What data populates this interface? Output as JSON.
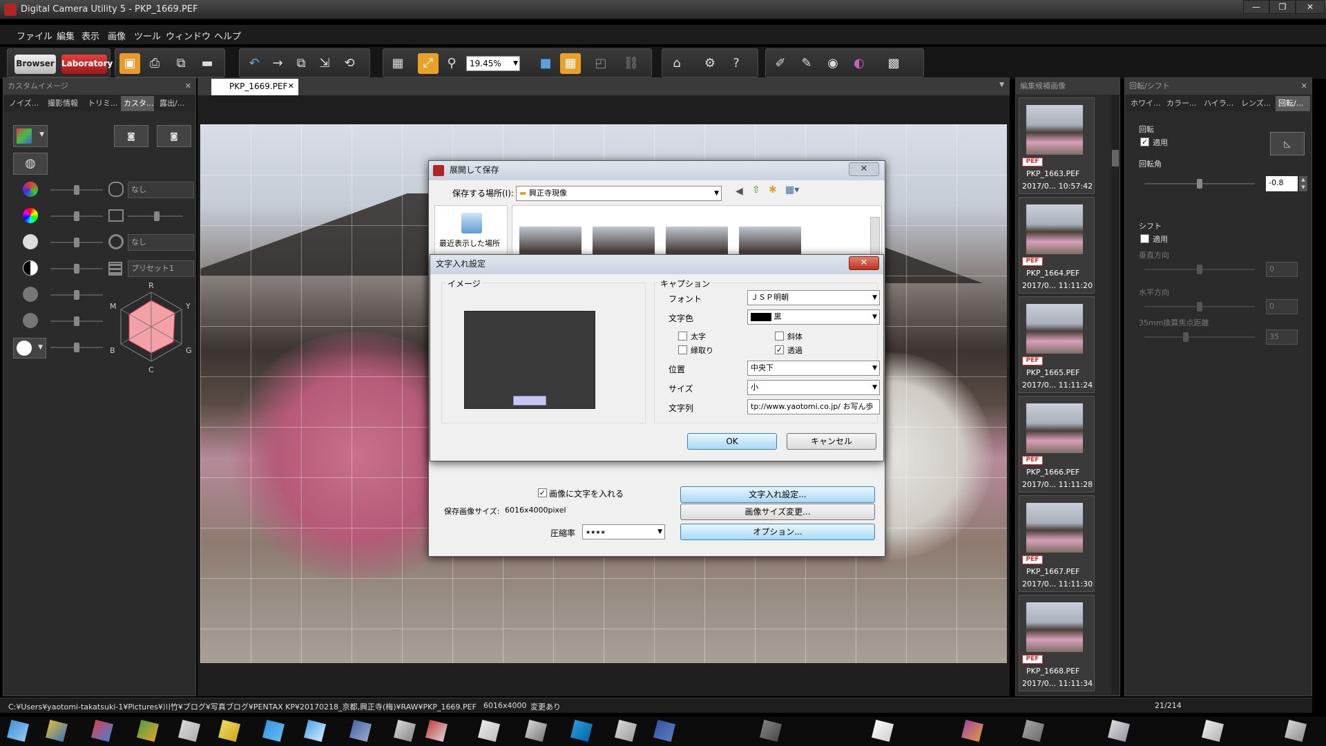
{
  "window": {
    "title": "Digital Camera Utility 5 - PKP_1669.PEF"
  },
  "menu": [
    "ファイル",
    "編集",
    "表示",
    "画像",
    "ツール",
    "ウィンドウ",
    "ヘルプ"
  ],
  "toolbar": {
    "browser_label": "Browser",
    "laboratory_label": "Laboratory",
    "zoom_value": "19.45%"
  },
  "left_panel": {
    "title": "カスタムイメージ",
    "tabs": [
      "ノイズ...",
      "撮影情報",
      "トリミ...",
      "カスタ...",
      "露出/..."
    ],
    "dropdowns": [
      "なし",
      "なし",
      "プリセット1"
    ],
    "radar_labels": {
      "top": "R",
      "top_right": "Y",
      "right": "G",
      "bottom": "C",
      "left": "B",
      "top_left": "M"
    }
  },
  "document": {
    "tab_label": "PKP_1669.PEF"
  },
  "save_dialog": {
    "title": "展開して保存",
    "save_location_label": "保存する場所(I):",
    "save_location_value": "興正寺現像",
    "recent_label": "最近表示した場所",
    "add_text_checkbox": "画像に文字を入れる",
    "add_text_checked": true,
    "save_size_label": "保存画像サイズ:",
    "save_size_value": "6016x4000pixel",
    "compression_label": "圧縮率",
    "compression_value": "★★★★",
    "text_settings_button": "文字入れ設定...",
    "resize_button": "画像サイズ変更...",
    "options_button": "オプション..."
  },
  "text_dialog": {
    "title": "文字入れ設定",
    "image_group": "イメージ",
    "caption_group": "キャプション",
    "font_label": "フォント",
    "font_value": "ＪＳＰ明朝",
    "color_label": "文字色",
    "color_value": "黒",
    "color_swatch": "#000000",
    "bold_label": "太字",
    "italic_label": "斜体",
    "outline_label": "縁取り",
    "transparent_label": "透過",
    "bold_checked": false,
    "italic_checked": false,
    "outline_checked": false,
    "transparent_checked": true,
    "position_label": "位置",
    "position_value": "中央下",
    "size_label": "サイズ",
    "size_value": "小",
    "text_label": "文字列",
    "text_value": "tp://www.yaotomi.co.jp/ お写ん歩",
    "ok_button": "OK",
    "cancel_button": "キャンセル"
  },
  "candidates_panel": {
    "title": "編集候補画像",
    "thumbs": [
      {
        "name": "PKP_1663.PEF",
        "date": "2017/0... 10:57:42",
        "badge": "PEF"
      },
      {
        "name": "PKP_1664.PEF",
        "date": "2017/0... 11:11:20",
        "badge": "PEF"
      },
      {
        "name": "PKP_1665.PEF",
        "date": "2017/0... 11:11:24",
        "badge": "PEF"
      },
      {
        "name": "PKP_1666.PEF",
        "date": "2017/0... 11:11:28",
        "badge": "PEF"
      },
      {
        "name": "PKP_1667.PEF",
        "date": "2017/0... 11:11:30",
        "badge": "PEF"
      },
      {
        "name": "PKP_1668.PEF",
        "date": "2017/0... 11:11:34",
        "badge": "PEF"
      }
    ]
  },
  "right_panel": {
    "title": "回転/シフト",
    "tabs": [
      "ホワイ...",
      "カラー...",
      "ハイラ...",
      "レンズ...",
      "回転/..."
    ],
    "rotate_group": "回転",
    "apply_label": "適用",
    "rotate_apply_checked": true,
    "rotate_angle_label": "回転角",
    "rotate_angle_value": "-0.8",
    "shift_group": "シフト",
    "shift_apply_checked": false,
    "vertical_label": "垂直方向",
    "vertical_value": "0",
    "horizontal_label": "水平方向",
    "horizontal_value": "0",
    "focal_label": "35mm換算焦点距離",
    "focal_value": "35"
  },
  "status": {
    "path": "C:¥Users¥yaotomi-takatsuki-1¥Pictures¥川竹¥ブログ¥写真ブログ¥PENTAX KP¥20170218_京都,興正寺(梅)¥RAW¥PKP_1669.PEF",
    "dimensions": "6016x4000",
    "modified": "変更あり",
    "counter": "21/214"
  }
}
